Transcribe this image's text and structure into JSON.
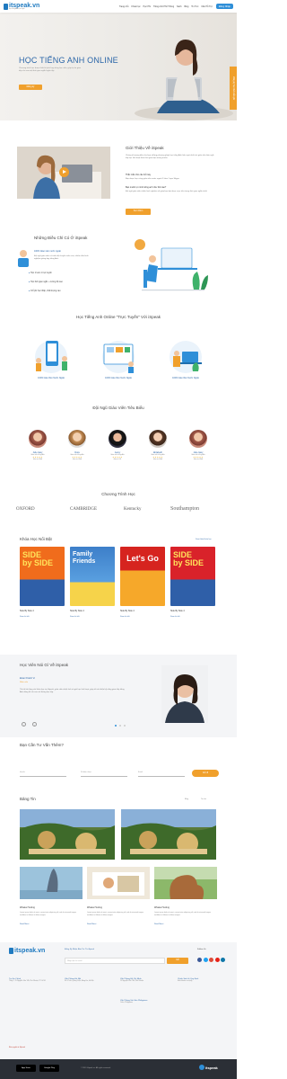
{
  "brand": {
    "name": "itspeak",
    "suffix": ".vn",
    "tagline": "Học tiếng Anh trực tuyến",
    "accent": "#2f8fd8",
    "orange": "#f0a02c"
  },
  "nav": {
    "items": [
      "Trang chủ",
      "Khóa học",
      "Học Phí",
      "Tiếng Anh Phổ Thông",
      "Sách",
      "Blog",
      "Tin Tức",
      "Cần Hỗ Trợ",
      "Giảng Viên",
      "Tài liệu"
    ],
    "cta": "Đăng Nhập"
  },
  "hero": {
    "title": "HỌC TIẾNG ANH ONLINE",
    "text": "Chương trình học được thiết kế phù hợp từng học viên, giúp tự tin giao tiếp chỉ sau một thời gian ngắn luyện tập",
    "button": "Đăng ký",
    "side_tab": "Đăng ký học thử miễn phí"
  },
  "intro": {
    "title": "Giới Thiệu Về iSpeak",
    "p1": "Chúng tôi mang đến cho bạn những phương pháp học tiếng Anh hiệu quả nhất với giáo viên bản ngữ, lớp học linh hoạt theo thời gian bạn mong muốn.",
    "q1": "Thắc mắc cho câu hỏi này",
    "q1a": "Bạn được học cùng giáo viên nước ngoài 1 kèm 1 qua Skype.",
    "q2": "Bạn muốn tự mình tiếng anh như thế nào?",
    "q2a": "Đội ngũ giáo viên nhiều kinh nghiệm sẽ giúp bạn đạt được mục tiêu trong thời gian ngắn nhất.",
    "button": "Xem thêm"
  },
  "features": {
    "title": "Những Điều Chỉ Có Ở iSpeak",
    "items": [
      "100% Giáo viên nước ngoài",
      "Học 1 kèm 1 trực tuyến",
      "Học thời gian ngắn - cường độ cao",
      "Chỉ phí học thấp, chất lượng cao"
    ],
    "desc": "Đội ngũ giáo viên có trình độ chuyên môn cao, nhiều năm kinh nghiệm giảng dạy tiếng Anh."
  },
  "online": {
    "title": "Học Tiếng Anh Online \"Trực Tuyến\" Với iSpeak",
    "cards": [
      {
        "label": "100% Giáo Viên Nước Ngoài"
      },
      {
        "label": "100% Giáo Viên Nước Ngoài"
      },
      {
        "label": "100% Giáo Viên Nước Ngoài"
      }
    ]
  },
  "teachers": {
    "title": "Đội Ngũ Giáo Viên Tiêu Biểu",
    "list": [
      {
        "name": "Julie Gary",
        "role": "Giáo viên tiếng Anh",
        "country": "Đến từ USA"
      },
      {
        "name": "Dora",
        "role": "Giáo viên tiếng Anh",
        "country": "Đến từ USA"
      },
      {
        "name": "Jenny",
        "role": "Giáo viên tiếng Anh",
        "country": "Đến từ UK"
      },
      {
        "name": "Elizabeth",
        "role": "Giáo viên tiếng Anh",
        "country": "Đến từ USA"
      },
      {
        "name": "Julie Gary",
        "role": "Giáo viên tiếng Anh",
        "country": "Đến từ USA"
      }
    ]
  },
  "programs": {
    "title": "Chương Trình Học",
    "logos": [
      "OXFORD",
      "CAMBRIDGE",
      "Kentucky",
      "Southampton"
    ]
  },
  "courses": {
    "title": "Khóa Học Nổi Bật",
    "more": "Xem thêm khóa học",
    "list": [
      {
        "name": "Side By Side 4",
        "link": "Xem chi tiết"
      },
      {
        "name": "Side By Side 4",
        "link": "Xem chi tiết"
      },
      {
        "name": "Side By Side 4",
        "link": "Xem chi tiết"
      },
      {
        "name": "Side By Side 4",
        "link": "Xem chi tiết"
      }
    ]
  },
  "testimonial": {
    "title": "Học Viên Nói Gì Về iSpeak",
    "name": "Đoàn Khánh Vi",
    "role": "Nhân viên",
    "quote": "Tôi rất hài lòng với khóa học tại iSpeak, giáo viên nhiệt tình và giờ học linh hoạt, giúp tôi cải thiện kỹ năng giao tiếp tiếng Anh đáng kể chỉ sau vài tháng học tập."
  },
  "consult": {
    "title": "Bạn Cần Tư Vấn Thêm?",
    "name_ph": "Họ tên",
    "phone_ph": "Số điện thoại",
    "email_ph": "Email",
    "button": "Gửi đi"
  },
  "news": {
    "title": "Bảng Tin",
    "tabs": [
      "Blog",
      "Tin tức"
    ],
    "posts": [
      {
        "title": "Whales Hunting",
        "text": "Lorem ipsum dolor sit amet, consectetur adipiscing elit, sed do eiusmod tempor incididunt ut labore et dolore magna.",
        "more": "Read More"
      },
      {
        "title": "Whales Hunting",
        "text": "Lorem ipsum dolor sit amet, consectetur adipiscing elit, sed do eiusmod tempor incididunt ut labore et dolore magna.",
        "more": "Read More"
      },
      {
        "title": "Whales Hunting",
        "text": "Lorem ipsum dolor sit amet, consectetur adipiscing elit, sed do eiusmod tempor incididunt ut labore et dolore magna.",
        "more": "Read More"
      }
    ]
  },
  "footer": {
    "subscribe_title": "Đăng Ký Nhận Bản Tin Từ iSpeak",
    "subscribe_ph": "Nhập địa chỉ email",
    "subscribe_btn": "Gửi",
    "follow": "Follow Us",
    "cols": [
      {
        "title": "Trụ Sở Chính",
        "text": "Tầng 5, 15 Nguyễn Văn Trỗi, Phú Nhuận, TP. HCM"
      },
      {
        "title": "Văn Phòng Hà Nội",
        "text": "Số 9 Trần Quang Diệu, Đống Đa, Hà Nội"
      },
      {
        "title": "Văn Phòng Hồ Chí Minh",
        "text": "15 Nguyễn Văn Trỗi, Phú Nhuận"
      },
      {
        "title": "Chính Sách & Quy Định",
        "text": "Điều khoản sử dụng"
      }
    ],
    "extra_col": {
      "title": "Văn Phòng Sài Gòn Philippines",
      "text": "Cebu, Philippines"
    },
    "made_by": "Bản quyền ♥ iSpeak",
    "app_store": "App Store",
    "google_play": "Google Play",
    "copyright": "© 2019 iSpeak.vn. All rights reserved."
  }
}
